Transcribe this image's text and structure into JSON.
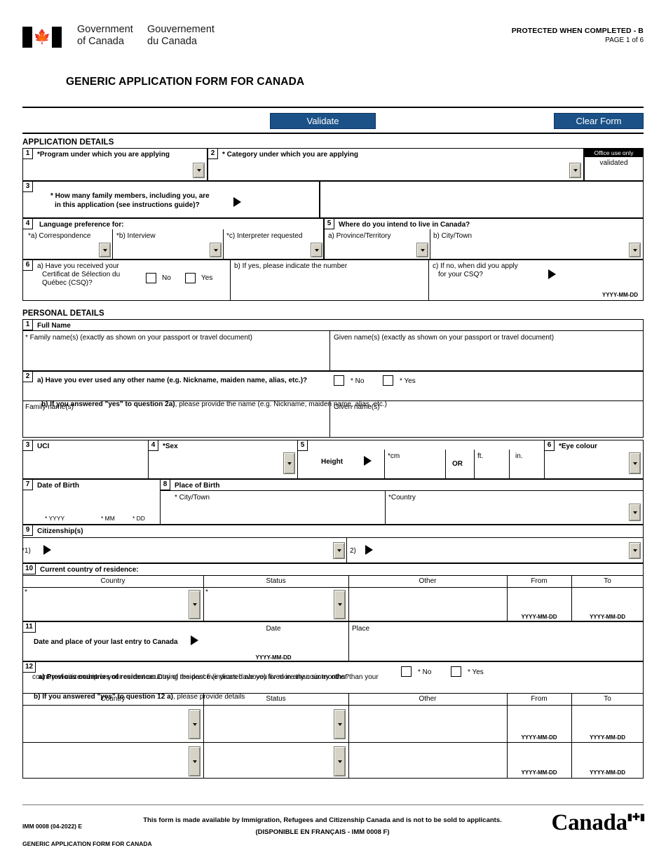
{
  "header": {
    "gov_en_line1": "Government",
    "gov_en_line2": "of Canada",
    "gov_fr_line1": "Gouvernement",
    "gov_fr_line2": "du Canada",
    "protected": "PROTECTED WHEN COMPLETED - B",
    "page": "PAGE 1 of 6",
    "form_title": "GENERIC APPLICATION FORM FOR CANADA"
  },
  "toolbar": {
    "validate_label": "Validate",
    "clear_label": "Clear Form",
    "button_color": "#1b5187"
  },
  "application_details": {
    "section_title": "APPLICATION DETAILS",
    "q1": {
      "num": "1",
      "label": "*Program under which you are applying",
      "value": ""
    },
    "q2": {
      "num": "2",
      "label": "* Category under which you are applying",
      "value": ""
    },
    "office": {
      "header": "Office use only",
      "value": "validated"
    },
    "q3": {
      "num": "3",
      "label_line1": "* How many family members, including you, are",
      "label_line2": "in this application (see instructions guide)?",
      "value": ""
    },
    "q4": {
      "num": "4",
      "label": "Language preference for:",
      "a_label": "*a) Correspondence",
      "b_label": "*b) Interview",
      "c_label": "*c) Interpreter requested",
      "a_value": "",
      "b_value": "",
      "c_value": ""
    },
    "q5": {
      "num": "5",
      "label": "Where do you intend to live in Canada?",
      "a_label": "a) Province/Territory",
      "b_label": "b) City/Town",
      "a_value": "",
      "b_value": ""
    },
    "q6": {
      "num": "6",
      "a_line1": "a) Have you received your",
      "a_line2": "Certificat de Sélection du",
      "a_line3": "Québec (CSQ)?",
      "no_label": "No",
      "yes_label": "Yes",
      "b_label": "b) If yes, please indicate the number",
      "b_value": "",
      "c_line1": "c) If no, when did you apply",
      "c_line2": "for your CSQ?",
      "c_value": "",
      "date_format": "YYYY-MM-DD"
    }
  },
  "personal_details": {
    "section_title": "PERSONAL DETAILS",
    "q1": {
      "num": "1",
      "label": "Full Name",
      "family_label": "* Family name(s)  (exactly as shown on your passport or travel document)",
      "given_label": "Given name(s)  (exactly as shown on your passport or travel document)",
      "family_value": "",
      "given_value": ""
    },
    "q2": {
      "num": "2",
      "a_label": "a) Have you ever used any other name (e.g. Nickname, maiden name, alias, etc.)?",
      "no_label": "* No",
      "yes_label": "* Yes",
      "b_bold": "b) If you answered \"yes\" to question 2a)",
      "b_rest": ", please provide the name (e.g. Nickname, maiden name, alias, etc.)",
      "family_label": "Family name(s)",
      "given_label": "Given name(s)",
      "family_value": "",
      "given_value": ""
    },
    "q3": {
      "num": "3",
      "label": "UCI",
      "value": ""
    },
    "q4": {
      "num": "4",
      "label": "*Sex",
      "value": ""
    },
    "q5": {
      "num": "5",
      "label": "Height",
      "cm_label": "*cm",
      "or_label": "OR",
      "ft_label": "ft.",
      "in_label": "in.",
      "cm_value": "",
      "ft_value": "",
      "in_value": ""
    },
    "q6": {
      "num": "6",
      "label": "*Eye colour",
      "value": ""
    },
    "q7": {
      "num": "7",
      "label": "Date of Birth",
      "yyyy_label": "* YYYY",
      "mm_label": "* MM",
      "dd_label": "* DD",
      "yyyy_value": "",
      "mm_value": "",
      "dd_value": ""
    },
    "q8": {
      "num": "8",
      "label": "Place of Birth",
      "city_label": "* City/Town",
      "country_label": "*Country",
      "city_value": "",
      "country_value": ""
    },
    "q9": {
      "num": "9",
      "label": "Citizenship(s)",
      "item1_label": "*1)",
      "item2_label": "2)",
      "item1_value": "",
      "item2_value": ""
    },
    "q10": {
      "num": "10",
      "label": "Current country of residence:",
      "columns": [
        "Country",
        "Status",
        "Other",
        "From",
        "To"
      ],
      "rows": [
        {
          "country": "",
          "status": "",
          "other": "",
          "from": "",
          "to": "",
          "from_format": "YYYY-MM-DD",
          "to_format": "YYYY-MM-DD"
        }
      ]
    },
    "q11": {
      "num": "11",
      "label": "Date and place of your last entry to Canada",
      "date_label": "Date",
      "place_label": "Place",
      "date_value": "",
      "place_value": "",
      "date_format": "YYYY-MM-DD"
    },
    "q12": {
      "num": "12",
      "a_bold": "a) Previous countries of residence:",
      "a_rest1": " During the past five years have you lived in any country other than your",
      "a_line2": "country of citizenship or your current country of residence (indicated above) for more than six months?",
      "no_label": "* No",
      "yes_label": "* Yes",
      "b_bold": "b) If you answered \"yes\" to question 12 a)",
      "b_rest": ", please provide details",
      "columns": [
        "Country",
        "Status",
        "Other",
        "From",
        "To"
      ],
      "rows": [
        {
          "country": "",
          "status": "",
          "other": "",
          "from": "",
          "to": "",
          "from_format": "YYYY-MM-DD",
          "to_format": "YYYY-MM-DD"
        },
        {
          "country": "",
          "status": "",
          "other": "",
          "from": "",
          "to": "",
          "from_format": "YYYY-MM-DD",
          "to_format": "YYYY-MM-DD"
        }
      ]
    }
  },
  "footer": {
    "form_code": "IMM 0008 (04-2022) E",
    "form_name": "GENERIC APPLICATION FORM FOR CANADA",
    "notice_line1": "This form is made available by Immigration, Refugees and Citizenship Canada and is not to be sold to applicants.",
    "notice_line2": "(DISPONIBLE EN FRANÇAIS - IMM 0008 F)",
    "wordmark": "Canada"
  }
}
